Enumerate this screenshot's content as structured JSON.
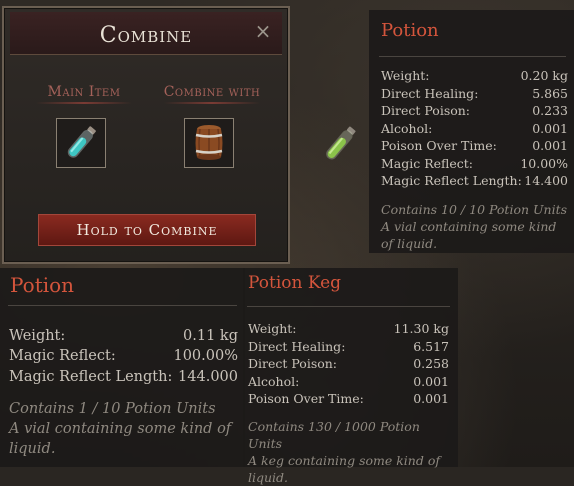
{
  "combine_dialog": {
    "title": "Combine",
    "close_label": "×",
    "main_item_label": "Main Item",
    "combine_with_label": "Combine with",
    "combine_button_label": "Hold to Combine",
    "main_item_icon": "potion-vial-icon",
    "combine_with_icon": "barrel-keg-icon"
  },
  "floating_item": {
    "icon": "green-potion-vial-icon"
  },
  "tooltip_1": {
    "title": "Potion",
    "stats": [
      {
        "label": "Weight:",
        "value": "0.20 kg"
      },
      {
        "label": "Direct Healing:",
        "value": "5.865"
      },
      {
        "label": "Direct Poison:",
        "value": "0.233"
      },
      {
        "label": "Alcohol:",
        "value": "0.001"
      },
      {
        "label": "Poison Over Time:",
        "value": "0.001"
      },
      {
        "label": "Magic Reflect:",
        "value": "10.00%"
      },
      {
        "label": "Magic Reflect Length:",
        "value": "14.400"
      }
    ],
    "contains": "Contains 10 / 10 Potion Units",
    "description": "A vial containing some kind of liquid."
  },
  "tooltip_2": {
    "title": "Potion",
    "stats": [
      {
        "label": "Weight:",
        "value": "0.11 kg"
      },
      {
        "label": "Magic Reflect:",
        "value": "100.00%"
      },
      {
        "label": "Magic Reflect Length:",
        "value": "144.000"
      }
    ],
    "contains": "Contains 1 / 10 Potion Units",
    "description": "A vial containing some kind of liquid."
  },
  "tooltip_3": {
    "title": "Potion Keg",
    "stats": [
      {
        "label": "Weight:",
        "value": "11.30 kg"
      },
      {
        "label": "Direct Healing:",
        "value": "6.517"
      },
      {
        "label": "Direct Poison:",
        "value": "0.258"
      },
      {
        "label": "Alcohol:",
        "value": "0.001"
      },
      {
        "label": "Poison Over Time:",
        "value": "0.001"
      }
    ],
    "contains": "Contains 130 / 1000 Potion Units",
    "description": "A keg containing some kind of liquid."
  }
}
